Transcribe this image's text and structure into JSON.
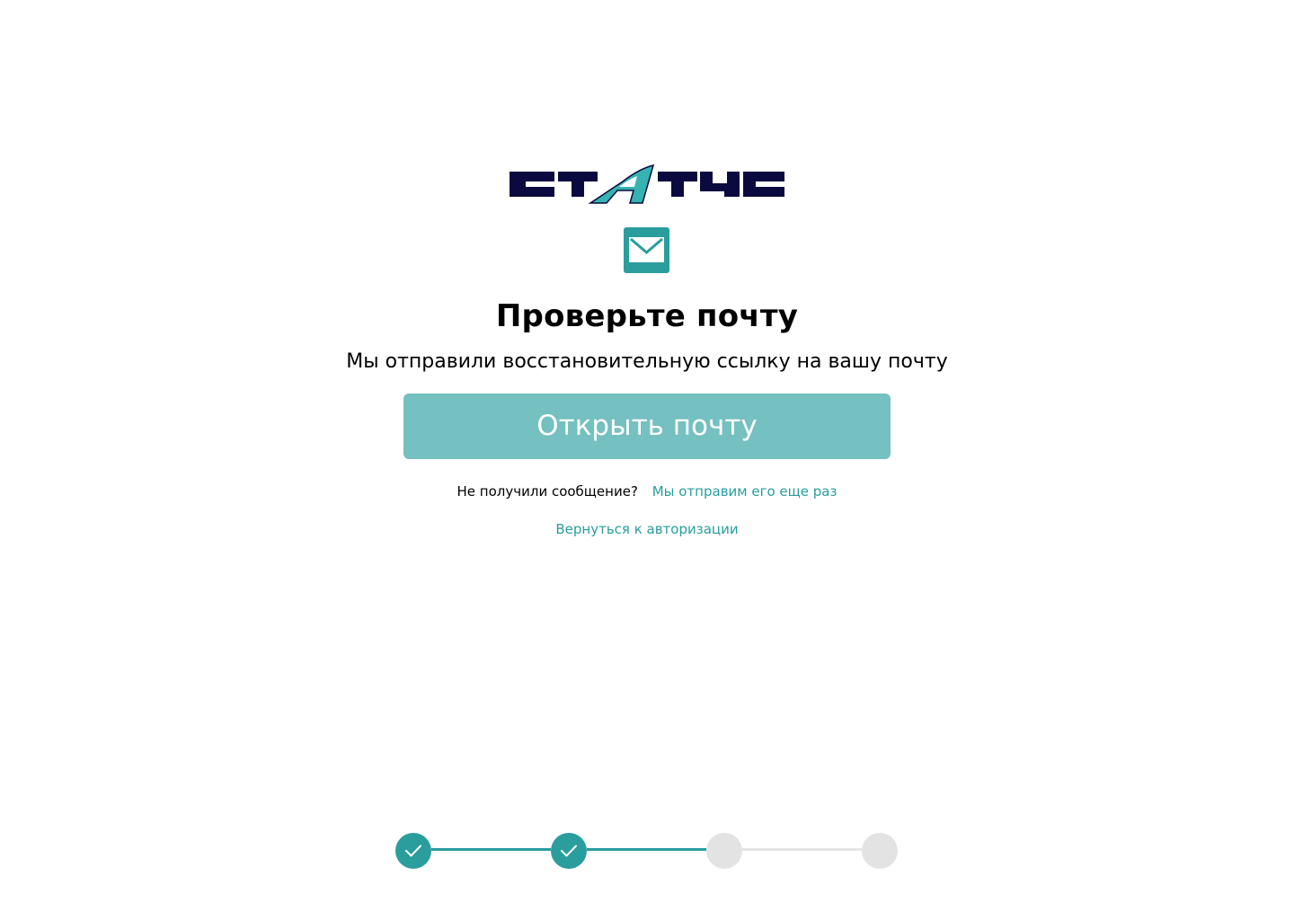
{
  "brand": {
    "logo_text": "СТАТУС",
    "colors": {
      "navy": "#0a0a40",
      "teal": "#35b3b1"
    }
  },
  "header": {
    "icon": "envelope-icon",
    "title": "Проверьте почту",
    "subtitle": "Мы отправили восстановительную ссылку на вашу почту"
  },
  "actions": {
    "open_mail_label": "Открыть почту",
    "resend_question": "Не получили сообщение?",
    "resend_link": "Мы отправим его еще раз",
    "back_link": "Вернуться к авторизации"
  },
  "stepper": {
    "total_steps": 4,
    "completed_steps": 2,
    "steps": [
      {
        "status": "completed",
        "icon": "check-icon"
      },
      {
        "status": "completed",
        "icon": "check-icon"
      },
      {
        "status": "pending"
      },
      {
        "status": "pending"
      }
    ]
  },
  "colors": {
    "accent": "#2a9d9d",
    "button_bg": "#75c0c0",
    "inactive": "#e3e3e3",
    "text": "#000000"
  }
}
